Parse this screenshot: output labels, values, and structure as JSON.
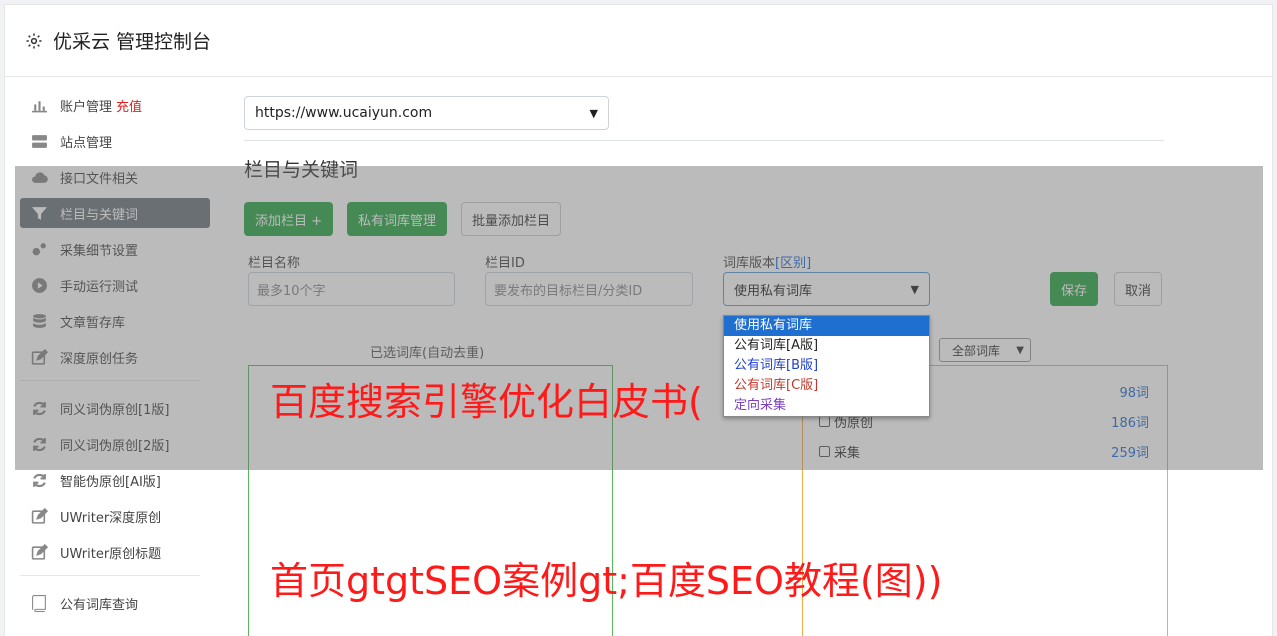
{
  "header": {
    "title": "优采云 管理控制台"
  },
  "sidebar": {
    "items": [
      {
        "label": "账户管理",
        "extra": "充值"
      },
      {
        "label": "站点管理"
      },
      {
        "label": "接口文件相关"
      },
      {
        "label": "栏目与关键词"
      },
      {
        "label": "采集细节设置"
      },
      {
        "label": "手动运行测试"
      },
      {
        "label": "文章暂存库"
      },
      {
        "label": "深度原创任务"
      },
      {
        "label": "同义词伪原创[1版]"
      },
      {
        "label": "同义词伪原创[2版]"
      },
      {
        "label": "智能伪原创[AI版]"
      },
      {
        "label": "UWriter深度原创"
      },
      {
        "label": "UWriter原创标题"
      },
      {
        "label": "公有词库查询"
      }
    ]
  },
  "main": {
    "site_select": "https://www.ucaiyun.com",
    "section_title": "栏目与关键词",
    "buttons": {
      "add_column": "添加栏目 +",
      "private_lib": "私有词库管理",
      "batch_add": "批量添加栏目"
    },
    "form": {
      "name_label": "栏目名称",
      "name_placeholder": "最多10个字",
      "id_label": "栏目ID",
      "id_placeholder": "要发布的目标栏目/分类ID",
      "version_label": "词库版本",
      "version_diff": "[区别]",
      "version_value": "使用私有词库",
      "save": "保存",
      "cancel": "取消"
    },
    "selected_lib_title": "已选词库(自动去重)",
    "all_lib_select": "全部词库",
    "libraries": [
      {
        "name": "",
        "count": "98词"
      },
      {
        "name": "伪原创",
        "count": "186词"
      },
      {
        "name": "采集",
        "count": "259词"
      }
    ],
    "dropdown_options": [
      "使用私有词库",
      "公有词库[A版]",
      "公有词库[B版]",
      "公有词库[C版]",
      "定向采集"
    ]
  },
  "watermarks": {
    "line1": "百度搜索引擎优化白皮书(",
    "line2": "首页gtgtSEO案例gt;百度SEO教程(图))"
  },
  "colors": {
    "active": "#6c757d",
    "green": "#28a745",
    "link": "#1e6bd6",
    "watermark": "#ff1a1a"
  }
}
